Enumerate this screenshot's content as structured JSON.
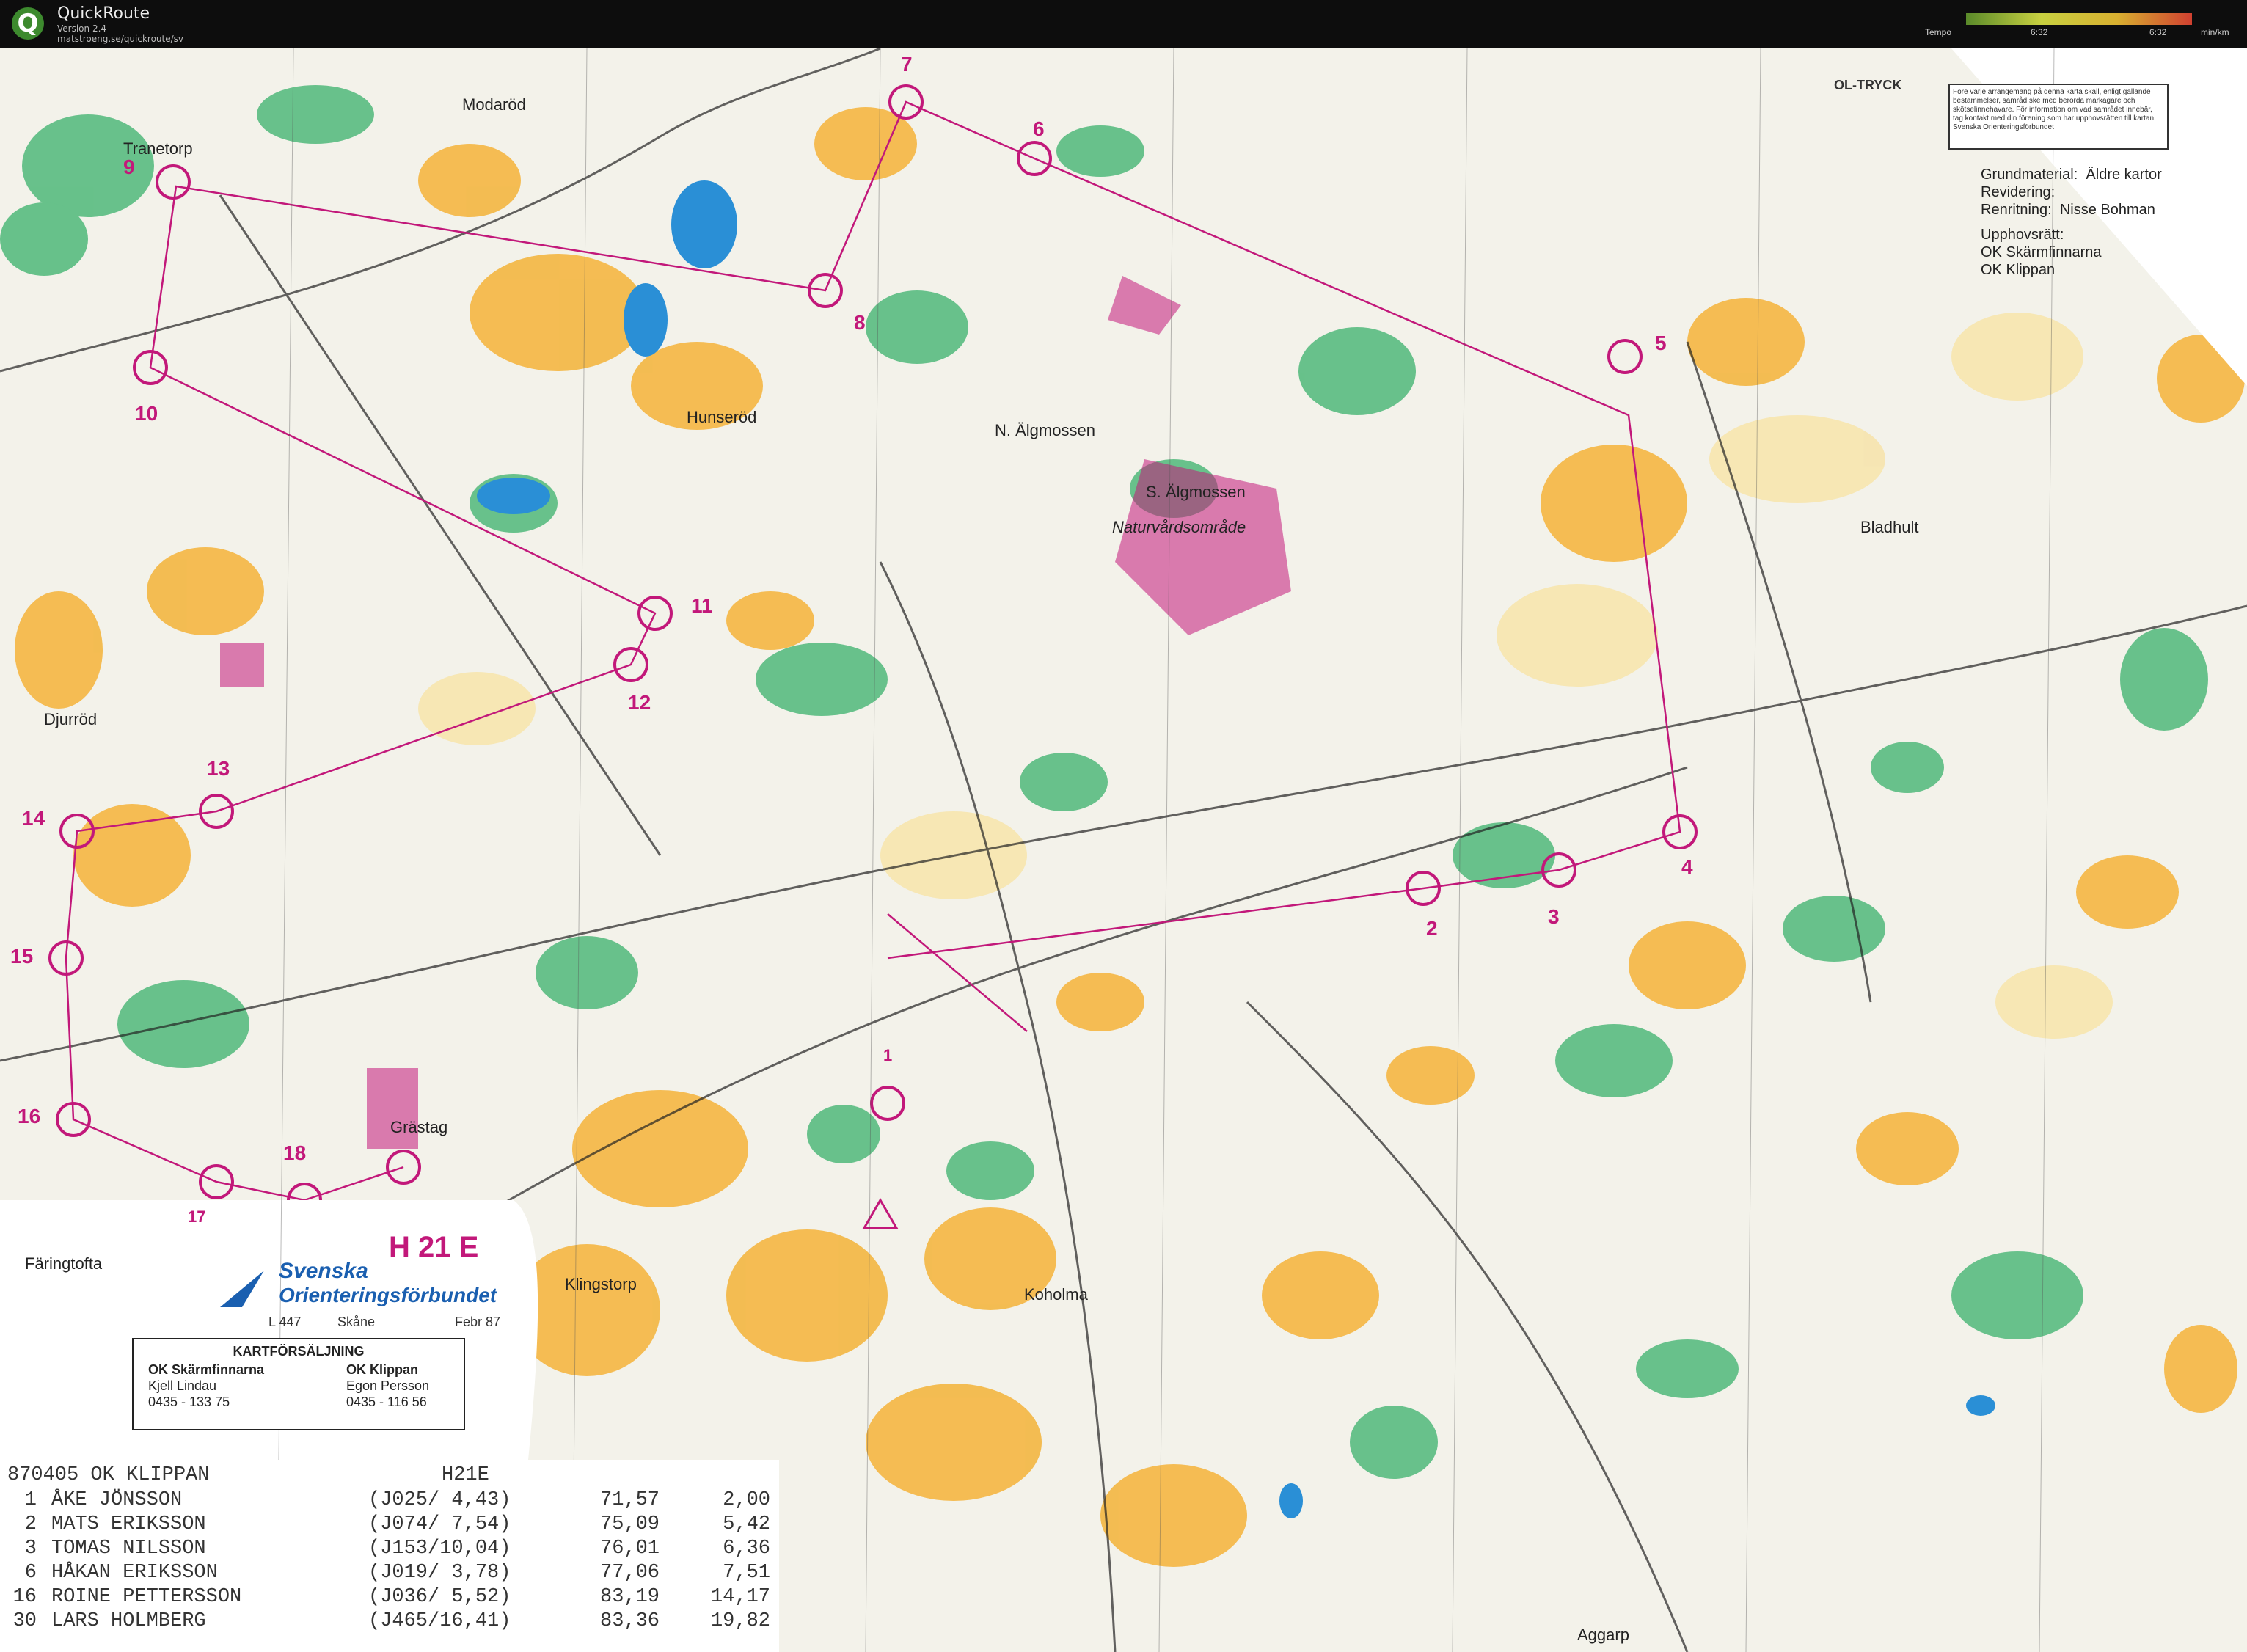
{
  "app": {
    "name": "QuickRoute",
    "version": "Version 2.4",
    "url": "matstroeng.se/quickroute/sv",
    "logo_letter": "Q"
  },
  "tempo_legend": {
    "label": "Tempo",
    "left_value": "6:32",
    "right_value": "6:32",
    "unit": "min/km"
  },
  "map": {
    "places": {
      "tranetorp": "Tranetorp",
      "modarod": "Modaröd",
      "hunserod": "Hunseröd",
      "n_algmossen": "N. Älgmossen",
      "s_algmossen": "S. Älgmossen",
      "naturvard": "Naturvårdsområde",
      "bladhult": "Bladhult",
      "djurrod": "Djurröd",
      "grastag": "Grästag",
      "faringtofta": "Färingtofta",
      "klingstorp": "Klingstorp",
      "koholma": "Koholma",
      "aggarp": "Aggarp"
    },
    "controls": [
      "1",
      "2",
      "3",
      "4",
      "5",
      "6",
      "7",
      "8",
      "9",
      "10",
      "11",
      "12",
      "13",
      "14",
      "15",
      "16",
      "17",
      "18"
    ],
    "ol_tryck": "OL-TRYCK",
    "copyright_note": "Före varje arrangemang på denna karta skall, enligt gällande bestämmelser, samråd ske med berörda markägare och skötselinnehavare. För information om vad samrådet innebär, tag kontakt med din förening som har upphovsrätten till kartan. Svenska Orienteringsförbundet",
    "info": {
      "grundmaterial_label": "Grundmaterial:",
      "grundmaterial_value": "Äldre kartor",
      "revidering_label": "Revidering:",
      "renritning_label": "Renritning:",
      "revidering_value": "Nisse Bohman",
      "upphovsratt_label": "Upphovsrätt:",
      "club1": "OK Skärmfinnarna",
      "club2": "OK Klippan"
    },
    "class_title": "H 21 E",
    "logo": {
      "line1": "Svenska",
      "line2": "Orienteringsförbundet",
      "code": "L 447",
      "region": "Skåne",
      "date": "Febr 87"
    },
    "sales": {
      "title": "KARTFÖRSÄLJNING",
      "left_club": "OK Skärmfinnarna",
      "left_name": "Kjell Lindau",
      "left_phone": "0435 - 133 75",
      "right_club": "OK Klippan",
      "right_name": "Egon Persson",
      "right_phone": "0435 - 116 56"
    }
  },
  "results": {
    "header_left": "870405 OK KLIPPAN",
    "header_class": "H21E",
    "rows": [
      {
        "place": "1",
        "name": "ÅKE JÖNSSON",
        "paren": "(J025/ 4,43)",
        "time": "71,57",
        "diff": "2,00"
      },
      {
        "place": "2",
        "name": "MATS ERIKSSON",
        "paren": "(J074/ 7,54)",
        "time": "75,09",
        "diff": "5,42"
      },
      {
        "place": "3",
        "name": "TOMAS NILSSON",
        "paren": "(J153/10,04)",
        "time": "76,01",
        "diff": "6,36"
      },
      {
        "place": "6",
        "name": "HÅKAN ERIKSSON",
        "paren": "(J019/ 3,78)",
        "time": "77,06",
        "diff": "7,51"
      },
      {
        "place": "16",
        "name": "ROINE PETTERSSON",
        "paren": "(J036/ 5,52)",
        "time": "83,19",
        "diff": "14,17"
      },
      {
        "place": "30",
        "name": "LARS HOLMBERG",
        "paren": "(J465/16,41)",
        "time": "83,36",
        "diff": "19,82"
      }
    ]
  }
}
